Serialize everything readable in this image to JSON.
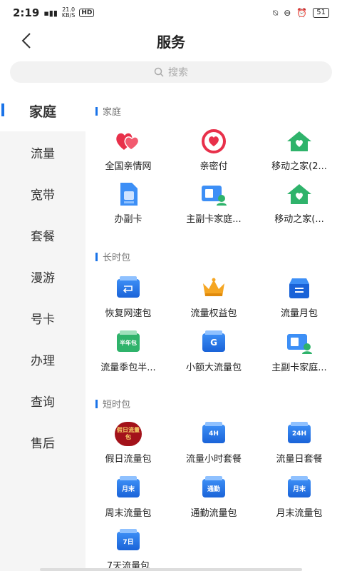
{
  "status": {
    "time": "2:19",
    "net_speed_top": "21.0",
    "net_speed_bottom": "KB/S",
    "hd": "HD",
    "battery": "51"
  },
  "header": {
    "title": "服务"
  },
  "search": {
    "placeholder": "搜索"
  },
  "sidebar": {
    "items": [
      {
        "label": "家庭",
        "active": true
      },
      {
        "label": "流量"
      },
      {
        "label": "宽带"
      },
      {
        "label": "套餐"
      },
      {
        "label": "漫游"
      },
      {
        "label": "号卡"
      },
      {
        "label": "办理"
      },
      {
        "label": "查询"
      },
      {
        "label": "售后"
      }
    ]
  },
  "sections": [
    {
      "title": "家庭",
      "items": [
        {
          "label": "全国亲情网",
          "icon": "hearts-icon"
        },
        {
          "label": "亲密付",
          "icon": "heart-circle-icon"
        },
        {
          "label": "移动之家(2...",
          "icon": "green-home-icon"
        },
        {
          "label": "办副卡",
          "icon": "sim-card-icon"
        },
        {
          "label": "主副卡家庭...",
          "icon": "sim-user-icon"
        },
        {
          "label": "移动之家(...",
          "icon": "green-home-icon"
        }
      ]
    },
    {
      "title": "长时包",
      "items": [
        {
          "label": "恢复网速包",
          "icon": "restore-icon"
        },
        {
          "label": "流量权益包",
          "icon": "crown-icon"
        },
        {
          "label": "流量月包",
          "icon": "box-icon"
        },
        {
          "label": "流量季包半...",
          "icon": "half-year-icon",
          "badge": "半年包"
        },
        {
          "label": "小额大流量包",
          "icon": "g-card-icon",
          "badge": "G"
        },
        {
          "label": "主副卡家庭...",
          "icon": "sim-user-icon"
        }
      ]
    },
    {
      "title": "短时包",
      "items": [
        {
          "label": "假日流量包",
          "icon": "holiday-icon",
          "badge": "假日流量包"
        },
        {
          "label": "流量小时套餐",
          "icon": "hour-card-icon",
          "badge": "4H"
        },
        {
          "label": "流量日套餐",
          "icon": "day-card-icon",
          "badge": "24H"
        },
        {
          "label": "周末流量包",
          "icon": "weekend-card-icon",
          "badge": "月末"
        },
        {
          "label": "通勤流量包",
          "icon": "commute-card-icon",
          "badge": "通勤"
        },
        {
          "label": "月末流量包",
          "icon": "month-end-card-icon",
          "badge": "月末"
        },
        {
          "label": "7天流量包",
          "icon": "seven-day-card-icon",
          "badge": "7日"
        }
      ]
    }
  ],
  "colors": {
    "accent": "#1a73e8",
    "sidebar_bg": "#f5f5f5",
    "red": "#e8304a",
    "green": "#2fb36b"
  }
}
